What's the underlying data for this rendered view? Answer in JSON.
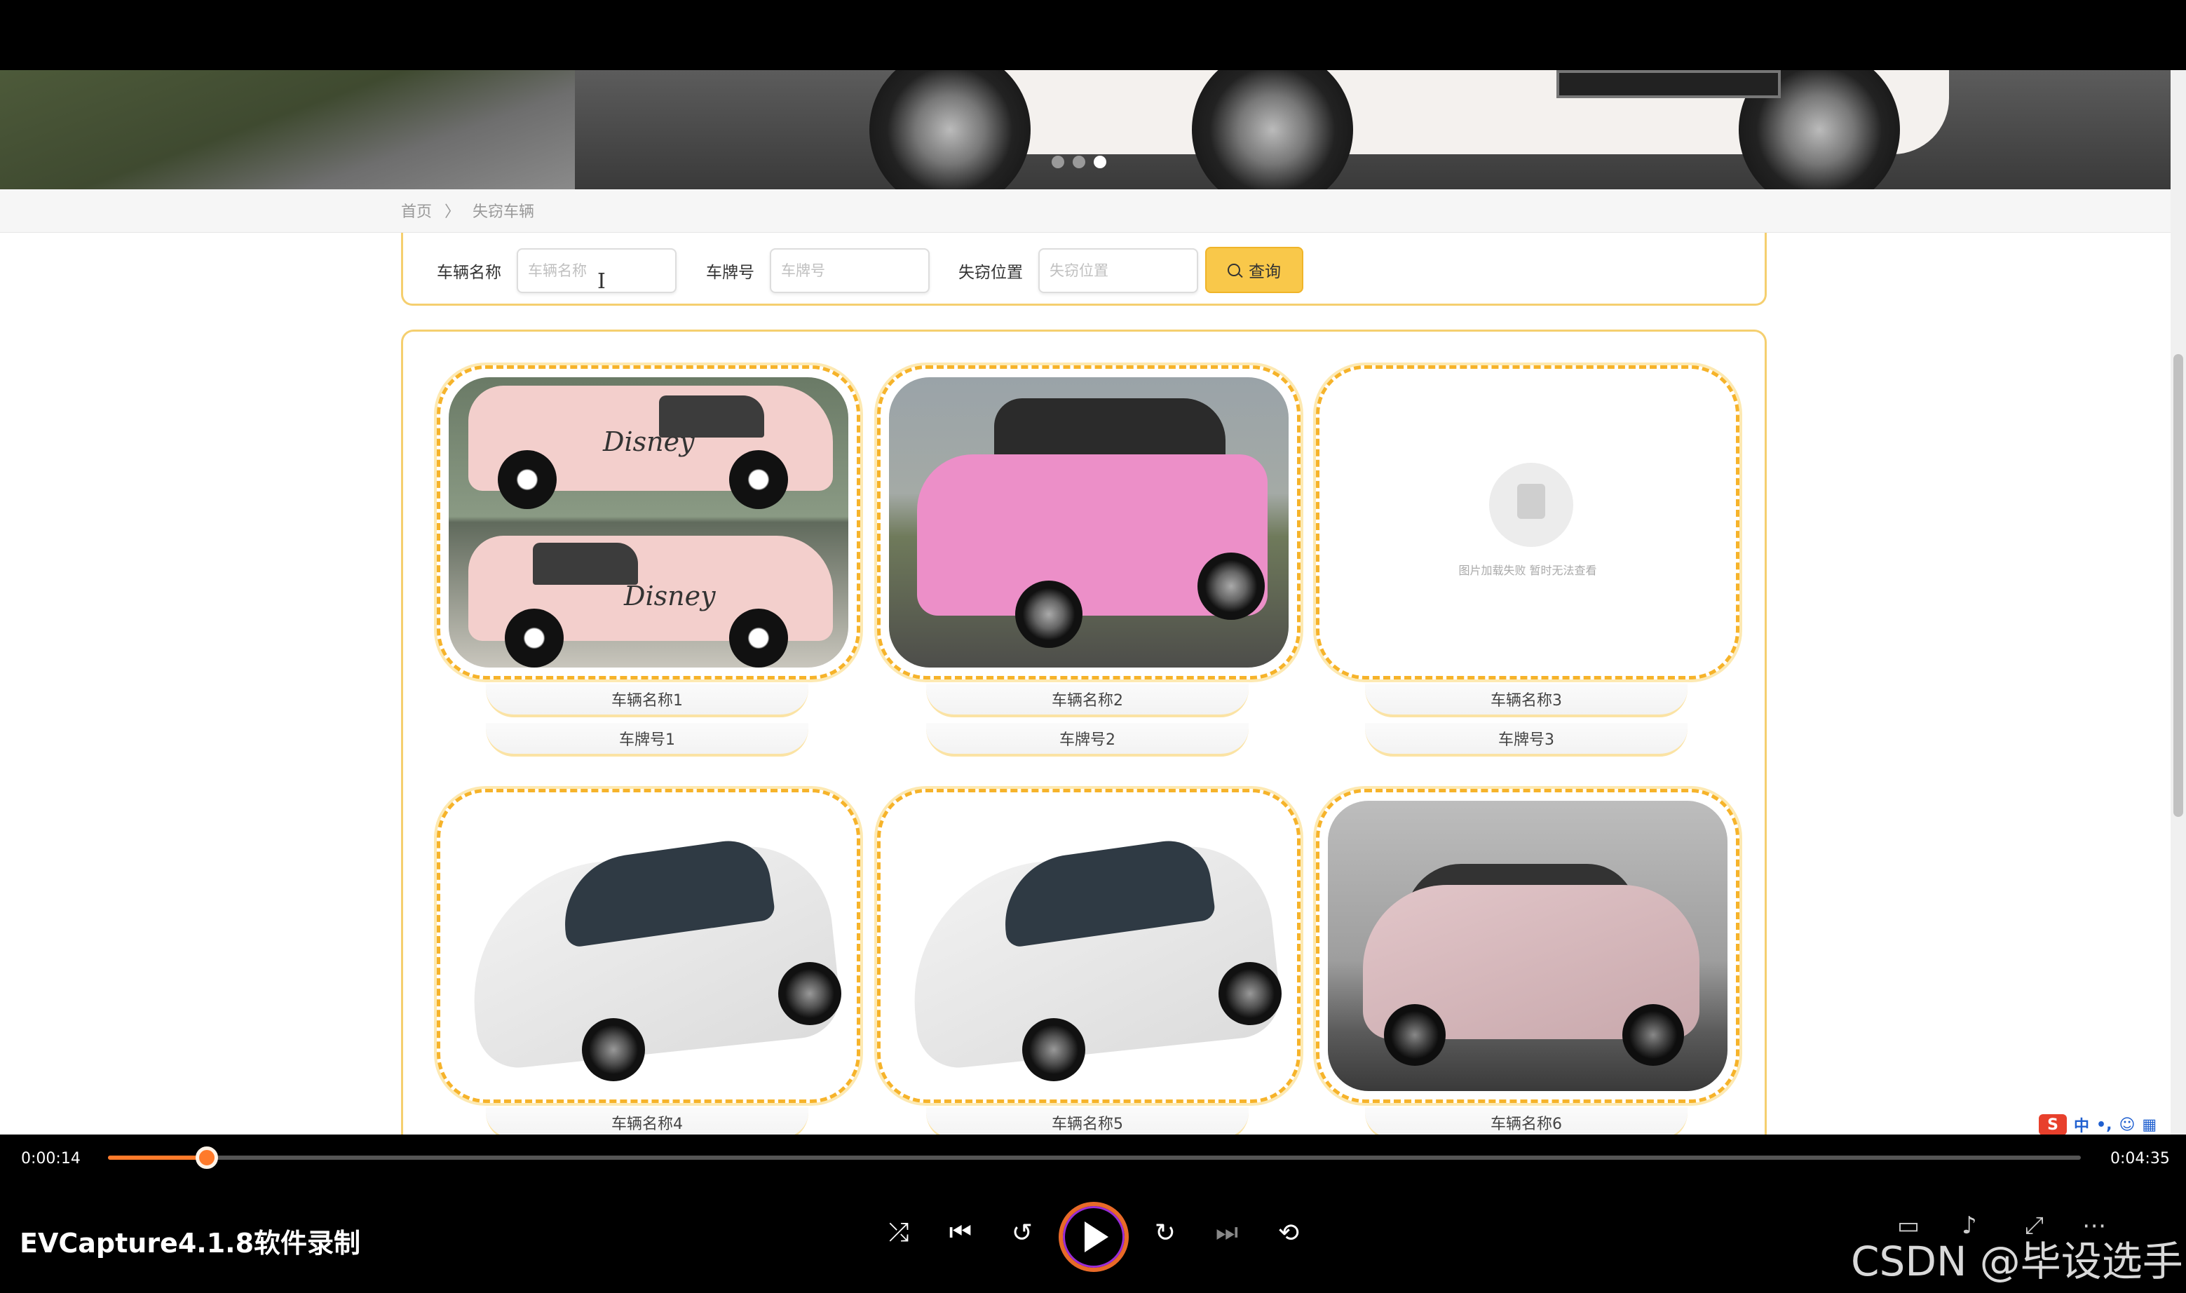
{
  "breadcrumb": {
    "home": "首页",
    "separator": "〉",
    "current": "失窃车辆"
  },
  "search": {
    "name_label": "车辆名称",
    "name_placeholder": "车辆名称",
    "plate_label": "车牌号",
    "plate_placeholder": "车牌号",
    "location_label": "失窃位置",
    "location_placeholder": "失窃位置",
    "button_label": "查询"
  },
  "carousel": {
    "slides": 3,
    "active_index": 2
  },
  "cards": [
    {
      "name": "车辆名称1",
      "plate": "车牌号1",
      "image": "pink-disney-car"
    },
    {
      "name": "车辆名称2",
      "plate": "车牌号2",
      "image": "pink-mini-car"
    },
    {
      "name": "车辆名称3",
      "plate": "车牌号3",
      "image": "broken-image",
      "broken_text": "图片加载失败 暂时无法查看"
    },
    {
      "name": "车辆名称4",
      "plate": "",
      "image": "white-ev-car"
    },
    {
      "name": "车辆名称5",
      "plate": "",
      "image": "white-ev-car"
    },
    {
      "name": "车辆名称6",
      "plate": "",
      "image": "pink-byd-dolphin"
    }
  ],
  "tray": {
    "ime_label": "中"
  },
  "player": {
    "current_time": "0:00:14",
    "total_time": "0:04:35",
    "progress_fraction": 0.05,
    "app_label": "EVCapture4.1.8软件录制",
    "watermark": "CSDN @毕设选手",
    "accent_color": "#ff7a2a"
  }
}
